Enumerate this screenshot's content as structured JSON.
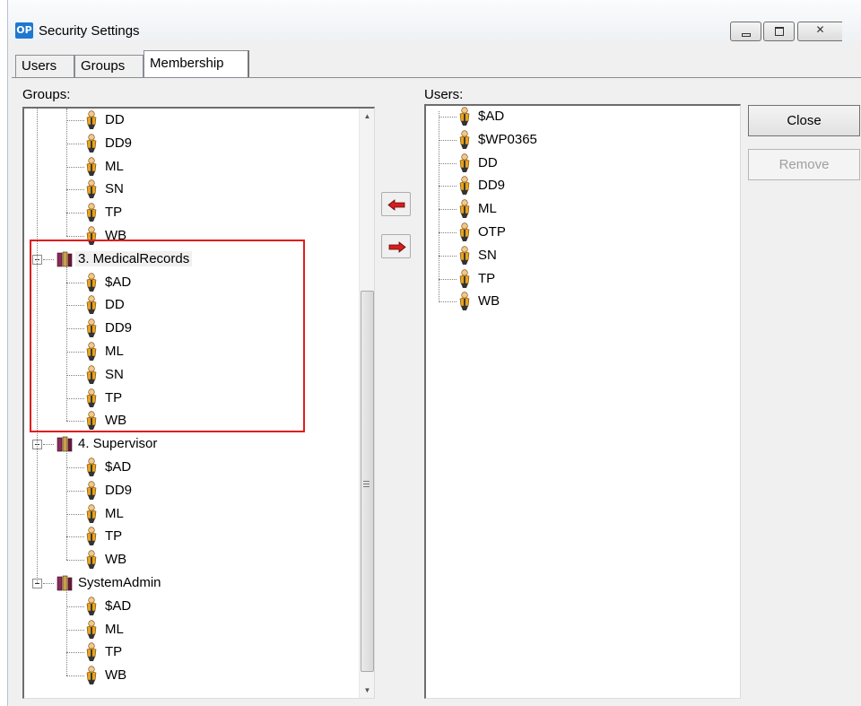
{
  "window": {
    "app_badge": "OP",
    "title": "Security Settings"
  },
  "tabs": [
    {
      "label": "Users",
      "active": false
    },
    {
      "label": "Groups",
      "active": false
    },
    {
      "label": "Membership",
      "active": true
    }
  ],
  "groups_panel": {
    "label": "Groups:",
    "nodes": [
      {
        "type": "user",
        "label": "DD"
      },
      {
        "type": "user",
        "label": "DD9"
      },
      {
        "type": "user",
        "label": "ML"
      },
      {
        "type": "user",
        "label": "SN"
      },
      {
        "type": "user",
        "label": "TP"
      },
      {
        "type": "user",
        "label": "WB"
      },
      {
        "type": "group",
        "label": "3. MedicalRecords",
        "selected": true
      },
      {
        "type": "user",
        "label": "$AD"
      },
      {
        "type": "user",
        "label": "DD"
      },
      {
        "type": "user",
        "label": "DD9"
      },
      {
        "type": "user",
        "label": "ML"
      },
      {
        "type": "user",
        "label": "SN"
      },
      {
        "type": "user",
        "label": "TP"
      },
      {
        "type": "user",
        "label": "WB"
      },
      {
        "type": "group",
        "label": "4. Supervisor"
      },
      {
        "type": "user",
        "label": "$AD"
      },
      {
        "type": "user",
        "label": "DD9"
      },
      {
        "type": "user",
        "label": "ML"
      },
      {
        "type": "user",
        "label": "TP"
      },
      {
        "type": "user",
        "label": "WB"
      },
      {
        "type": "group",
        "label": "SystemAdmin"
      },
      {
        "type": "user",
        "label": "$AD"
      },
      {
        "type": "user",
        "label": "ML"
      },
      {
        "type": "user",
        "label": "TP"
      },
      {
        "type": "user",
        "label": "WB"
      }
    ]
  },
  "users_panel": {
    "label": "Users:",
    "nodes": [
      "$AD",
      "$WP0365",
      "DD",
      "DD9",
      "ML",
      "OTP",
      "SN",
      "TP",
      "WB"
    ]
  },
  "buttons": {
    "close": "Close",
    "remove": "Remove"
  },
  "colors": {
    "highlight": "#e11d1d",
    "arrow": "#d91c1c",
    "user_icon_body": "#e8a21a",
    "group_icon": "#8a2a5a"
  }
}
